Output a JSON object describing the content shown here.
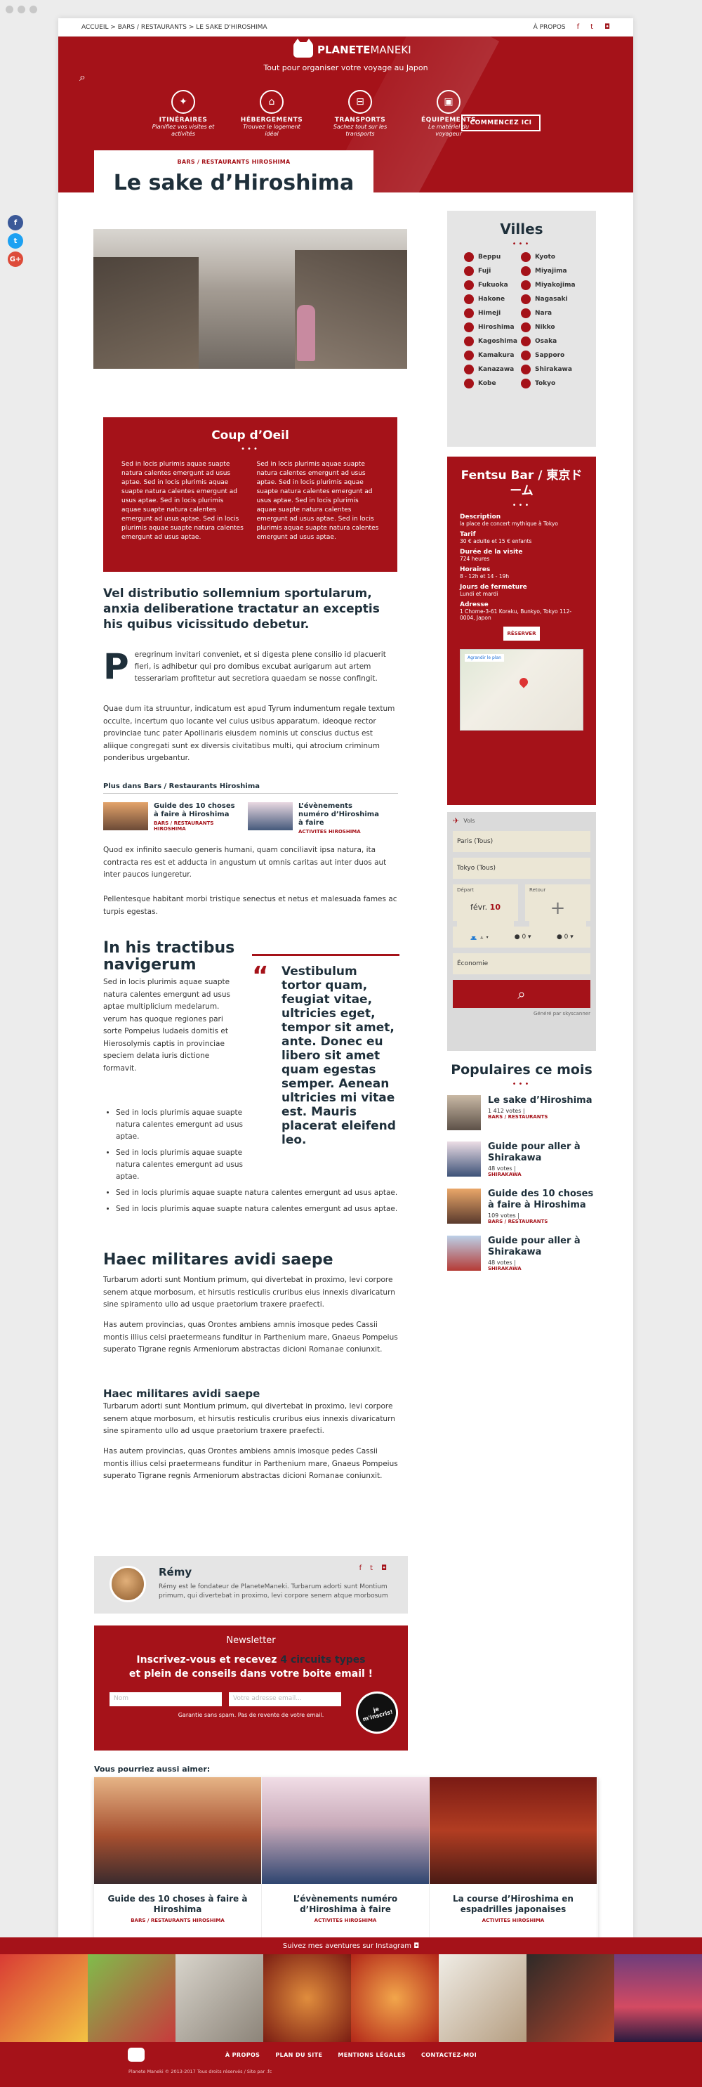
{
  "breadcrumb": "ACCUEIL > BARS / RESTAURANTS > LE SAKE D'HIROSHIMA",
  "top": {
    "about": "À PROPOS"
  },
  "brand": {
    "name_a": "PLANETE",
    "name_b": "MANEKI",
    "tagline": "Tout pour organiser votre voyage au Japon"
  },
  "nav": [
    {
      "title": "ITINÉRAIRES",
      "sub": "Planifiez vos visites et activités"
    },
    {
      "title": "HÉBERGEMENTS",
      "sub": "Trouvez le logement idéal"
    },
    {
      "title": "TRANSPORTS",
      "sub": "Sachez tout sur les transports"
    },
    {
      "title": "ÉQUIPEMENTS",
      "sub": "Le matériel du voyageur"
    }
  ],
  "cta": "COMMENCEZ ICI",
  "article": {
    "cat": "BARS / RESTAURANTS HIROSHIMA",
    "title": "Le sake d’Hiroshima",
    "coup_title": "Coup d’Oeil",
    "coup_col1": "Sed in locis plurimis aquae suapte natura calentes emergunt ad usus aptae. Sed in locis plurimis aquae suapte natura calentes emergunt ad usus aptae. Sed in locis plurimis aquae suapte natura calentes emergunt ad usus aptae. Sed in locis plurimis aquae suapte natura calentes emergunt ad usus aptae.",
    "coup_col2": "Sed in locis plurimis aquae suapte natura calentes emergunt ad usus aptae. Sed in locis plurimis aquae suapte natura calentes emergunt ad usus aptae. Sed in locis plurimis aquae suapte natura calentes emergunt ad usus aptae. Sed in locis plurimis aquae suapte natura calentes emergunt ad usus aptae.",
    "lead": "Vel distributio sollemnium sportularum, anxia deliberatione tractatur an exceptis his quibus vicissitudo debetur.",
    "drop_letter": "P",
    "drop_text": "eregrinum invitari conveniet, et si digesta plene consilio id placuerit fieri, is adhibetur qui pro domibus excubat aurigarum aut artem tesserariam profitetur aut secretiora quaedam se nosse confingit.",
    "p2": "Quae dum ita struuntur, indicatum est apud Tyrum indumentum regale textum occulte, incertum quo locante vel cuius usibus apparatum. ideoque rector provinciae tunc pater Apollinaris eiusdem nominis ut conscius ductus est aliique congregati sunt ex diversis civitatibus multi, qui atrocium criminum ponderibus urgebantur.",
    "plus_head": "Plus dans Bars / Restaurants Hiroshima",
    "plus": [
      {
        "title": "Guide des 10 choses à faire à Hiroshima",
        "cat": "BARS / RESTAURANTS HIROSHIMA"
      },
      {
        "title": "L’évènements numéro d’Hiroshima à faire",
        "cat": "ACTIVITES HIROSHIMA"
      }
    ],
    "p3": "Quod ex infinito saeculo generis humani, quam conciliavit ipsa natura, ita contracta res est et adducta in angustum ut omnis caritas aut inter duos aut inter paucos iungeretur.",
    "p4": "Pellentesque habitant morbi tristique senectus et netus et malesuada fames ac turpis egestas.",
    "h_tract": "In his tractibus navigerum",
    "p5": "Sed in locis plurimis aquae suapte natura calentes emergunt ad usus aptae multiplicium medelarum. verum has quoque regiones pari sorte Pompeius Iudaeis domitis et Hierosolymis captis in provinciae speciem delata iuris dictione formavit.",
    "quote": "Vestibulum tortor quam, feugiat vitae, ultricies eget, tempor sit amet, ante. Donec eu libero sit amet quam egestas semper. Aenean ultricies mi vitae est. Mauris placerat eleifend leo.",
    "bullets": [
      "Sed in locis plurimis aquae suapte natura calentes emergunt ad usus aptae.",
      "Sed in locis plurimis aquae suapte natura calentes emergunt ad usus aptae.",
      "Sed in locis plurimis aquae suapte natura calentes emergunt ad usus aptae.",
      "Sed in locis plurimis aquae suapte natura calentes emergunt ad usus aptae."
    ],
    "h_haec": "Haec militares avidi saepe",
    "p6": "Turbarum adorti sunt Montium primum, qui divertebat in proximo, levi corpore senem atque morbosum, et hirsutis resticulis cruribus eius innexis divaricaturn sine spiramento ullo ad usque praetorium traxere praefecti.",
    "p7": "Has autem provincias, quas Orontes ambiens amnis imosque pedes Cassii montis illius celsi praetermeans funditur in Parthenium mare, Gnaeus Pompeius superato Tigrane regnis Armeniorum abstractas dicioni Romanae coniunxit.",
    "h_haec2": "Haec militares avidi saepe",
    "p8": "Turbarum adorti sunt Montium primum, qui divertebat in proximo, levi corpore senem atque morbosum, et hirsutis resticulis cruribus eius innexis divaricaturn sine spiramento ullo ad usque praetorium traxere praefecti.",
    "p9": "Has autem provincias, quas Orontes ambiens amnis imosque pedes Cassii montis illius celsi praetermeans funditur in Parthenium mare, Gnaeus Pompeius superato Tigrane regnis Armeniorum abstractas dicioni Romanae coniunxit."
  },
  "author": {
    "name": "Rémy",
    "bio": "Rémy est le fondateur de PlaneteManeki. Turbarum adorti sunt Montium primum, qui divertebat in proximo, levi corpore senem atque morbosum"
  },
  "newsletter": {
    "head": "Newsletter",
    "line1": "Inscrivez-vous et recevez",
    "bold": "4 circuits types",
    "line2": "et plein de conseils dans votre boite email !",
    "name_ph": "Nom",
    "email_ph": "Votre adresse email...",
    "badge": "je m'inscris!",
    "guarantee": "Garantie sans spam. Pas de revente de votre email."
  },
  "villes": {
    "title": "Villes",
    "items": [
      "Beppu",
      "Kyoto",
      "Fuji",
      "Miyajima",
      "Fukuoka",
      "Miyakojima",
      "Hakone",
      "Nagasaki",
      "Himeji",
      "Nara",
      "Hiroshima",
      "Nikko",
      "Kagoshima",
      "Osaka",
      "Kamakura",
      "Sapporo",
      "Kanazawa",
      "Shirakawa",
      "Kobe",
      "Tokyo"
    ]
  },
  "fentsu": {
    "title": "Fentsu Bar / 東京ドーム",
    "desc_k": "Description",
    "desc_v": "la place de concert mythique à Tokyo",
    "tarif_k": "Tarif",
    "tarif_v": "30 € adulte et 15 € enfants",
    "duree_k": "Durée de la visite",
    "duree_v": "724 heures",
    "hor_k": "Horaires",
    "hor_v": "8 - 12h et 14 - 19h",
    "jours_k": "Jours de fermeture",
    "jours_v": "Lundi et mardi",
    "adr_k": "Adresse",
    "adr_v": "1 Chome-3-61 Koraku, Bunkyo, Tokyo 112-0004, Japon",
    "btn": "RÉSERVER",
    "map_btn": "Agrandir le plan"
  },
  "flights": {
    "tab": "Vols",
    "from": "Paris (Tous)",
    "to": "Tokyo (Tous)",
    "dep": "Départ",
    "ret": "Retour",
    "date": "févr.",
    "day": "10",
    "adults": "1",
    "kids": "0",
    "infants": "0",
    "cabin": "Économie",
    "powered": "Généré par skyscanner"
  },
  "popular": {
    "title": "Populaires ce mois",
    "items": [
      {
        "title": "Le sake d’Hiroshima",
        "votes": "1 412 votes |",
        "cat": "BARS / RESTAURANTS"
      },
      {
        "title": "Guide pour aller à Shirakawa",
        "votes": "48 votes |",
        "cat": "SHIRAKAWA"
      },
      {
        "title": "Guide des 10 choses à faire à Hiroshima",
        "votes": "109 votes |",
        "cat": "BARS / RESTAURANTS"
      },
      {
        "title": "Guide pour aller à Shirakawa",
        "votes": "48 votes |",
        "cat": "SHIRAKAWA"
      }
    ]
  },
  "aimer": {
    "title": "Vous pourriez aussi aimer:",
    "cards": [
      {
        "title": "Guide des 10 choses à faire à Hiroshima",
        "cat": "BARS / RESTAURANTS HIROSHIMA"
      },
      {
        "title": "L’évènements numéro d’Hiroshima à faire",
        "cat": "ACTIVITES HIROSHIMA"
      },
      {
        "title": "La course d’Hiroshima en espadrilles japonaises",
        "cat": "ACTIVITES HIROSHIMA"
      }
    ]
  },
  "insta": "Suivez mes aventures sur Instagram",
  "footer": {
    "links": [
      "À PROPOS",
      "PLAN DU SITE",
      "MENTIONS LÉGALES",
      "CONTACTEZ-MOI"
    ],
    "copy": "Planete Maneki © 2013-2017 Tous droits réservés / Site par .fc"
  },
  "colors": {
    "accent": "#a51219",
    "navy": "#1e2f3a"
  }
}
